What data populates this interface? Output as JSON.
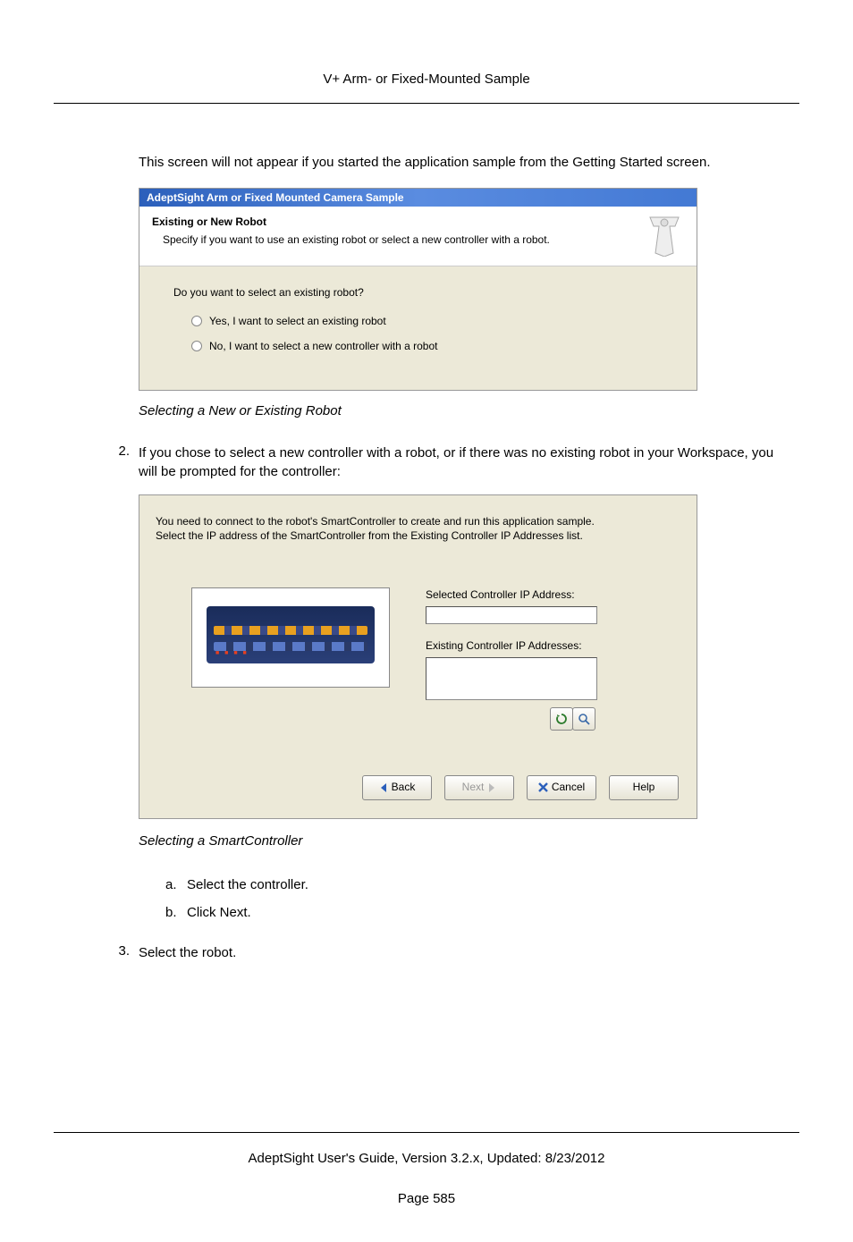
{
  "header": {
    "title": "V+ Arm- or Fixed-Mounted Sample"
  },
  "intro": "This screen will not appear if you started the application sample from the Getting Started screen.",
  "dialog1": {
    "titlebar": "AdeptSight Arm or Fixed Mounted Camera Sample",
    "heading": "Existing or New Robot",
    "subheading": "Specify if you want to use an existing robot or select a new controller with a robot.",
    "question": "Do you want to select an existing robot?",
    "option1": "Yes, I want to select an existing robot",
    "option2": "No, I want to select a new controller with a robot"
  },
  "caption1": "Selecting a New or Existing Robot",
  "step2": {
    "num": "2.",
    "text": "If you chose to select a new controller with a robot, or if there was no existing robot in your Workspace, you will be prompted for the controller:"
  },
  "dialog2": {
    "intro_line1": "You need to connect to the robot's SmartController to create and run this application sample.",
    "intro_line2": "Select the IP address of the SmartController from the Existing Controller IP Addresses list.",
    "selected_label": "Selected Controller IP Address:",
    "existing_label": "Existing Controller IP Addresses:",
    "btn_back": "Back",
    "btn_next": "Next",
    "btn_cancel": "Cancel",
    "btn_help": "Help"
  },
  "caption2": "Selecting a SmartController",
  "sub_steps": {
    "a_letter": "a.",
    "a_text": "Select the controller.",
    "b_letter": "b.",
    "b_text": "Click Next."
  },
  "step3": {
    "num": "3.",
    "text": "Select the robot."
  },
  "footer": {
    "line": "AdeptSight User's Guide,  Version 3.2.x, Updated: 8/23/2012",
    "page": "Page 585"
  }
}
